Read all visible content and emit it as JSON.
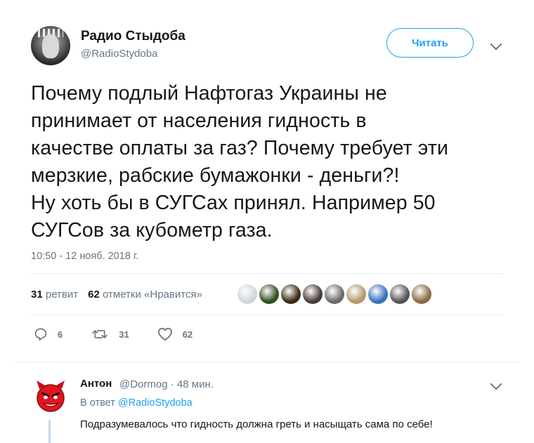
{
  "tweet": {
    "author": {
      "display_name": "Радио Стыдоба",
      "handle": "@RadioStydoba",
      "avatar_icon": "statue-of-liberty-facepalm-avatar"
    },
    "follow_label": "Читать",
    "text": "Почему подлый Нафтогаз Украины не\nпринимает от населения гидность в\nкачестве оплаты за газ? Почему требует эти\nмерзкие, рабские бумажонки - деньги?!\nНу хоть бы в СУГСах принял. Например 50\nСУГСов за кубометр газа.",
    "timestamp": "10:50 - 12 нояб. 2018 г.",
    "stats": {
      "retweets_count": "31",
      "retweets_label": "ретвит",
      "likes_count": "62",
      "likes_label": "отметки «Нравится»"
    },
    "likers": [
      {
        "name": "default-avatar",
        "color": "#ccd6dd"
      },
      {
        "name": "liker-avatar-green",
        "color": "#2f4f1f"
      },
      {
        "name": "liker-avatar-guitar",
        "color": "#3a2a10"
      },
      {
        "name": "liker-avatar-poster",
        "color": "#4a3a3a"
      },
      {
        "name": "liker-avatar-cartoon",
        "color": "#6b6b6b"
      },
      {
        "name": "liker-avatar-cat",
        "color": "#b59a6a"
      },
      {
        "name": "liker-avatar-flag",
        "color": "#3a6fc0"
      },
      {
        "name": "liker-avatar-portrait",
        "color": "#555555"
      },
      {
        "name": "liker-avatar-owl",
        "color": "#8a6a45"
      }
    ],
    "actions": {
      "reply_count": "6",
      "retweet_count": "31",
      "like_count": "62"
    }
  },
  "reply": {
    "display_name": "Антон",
    "handle": "@Dormog",
    "time": "48 мин.",
    "in_reply_prefix": "В ответ",
    "in_reply_handle": "@RadioStydoba",
    "text": "Подразумевалось что гидность должна греть и насыщать сама по себе!",
    "avatar_icon": "red-devil-smiley-avatar"
  },
  "colors": {
    "accent": "#1da1f2",
    "secondary_text": "#657786",
    "primary_text": "#14171a",
    "divider": "#e6ecf0"
  }
}
